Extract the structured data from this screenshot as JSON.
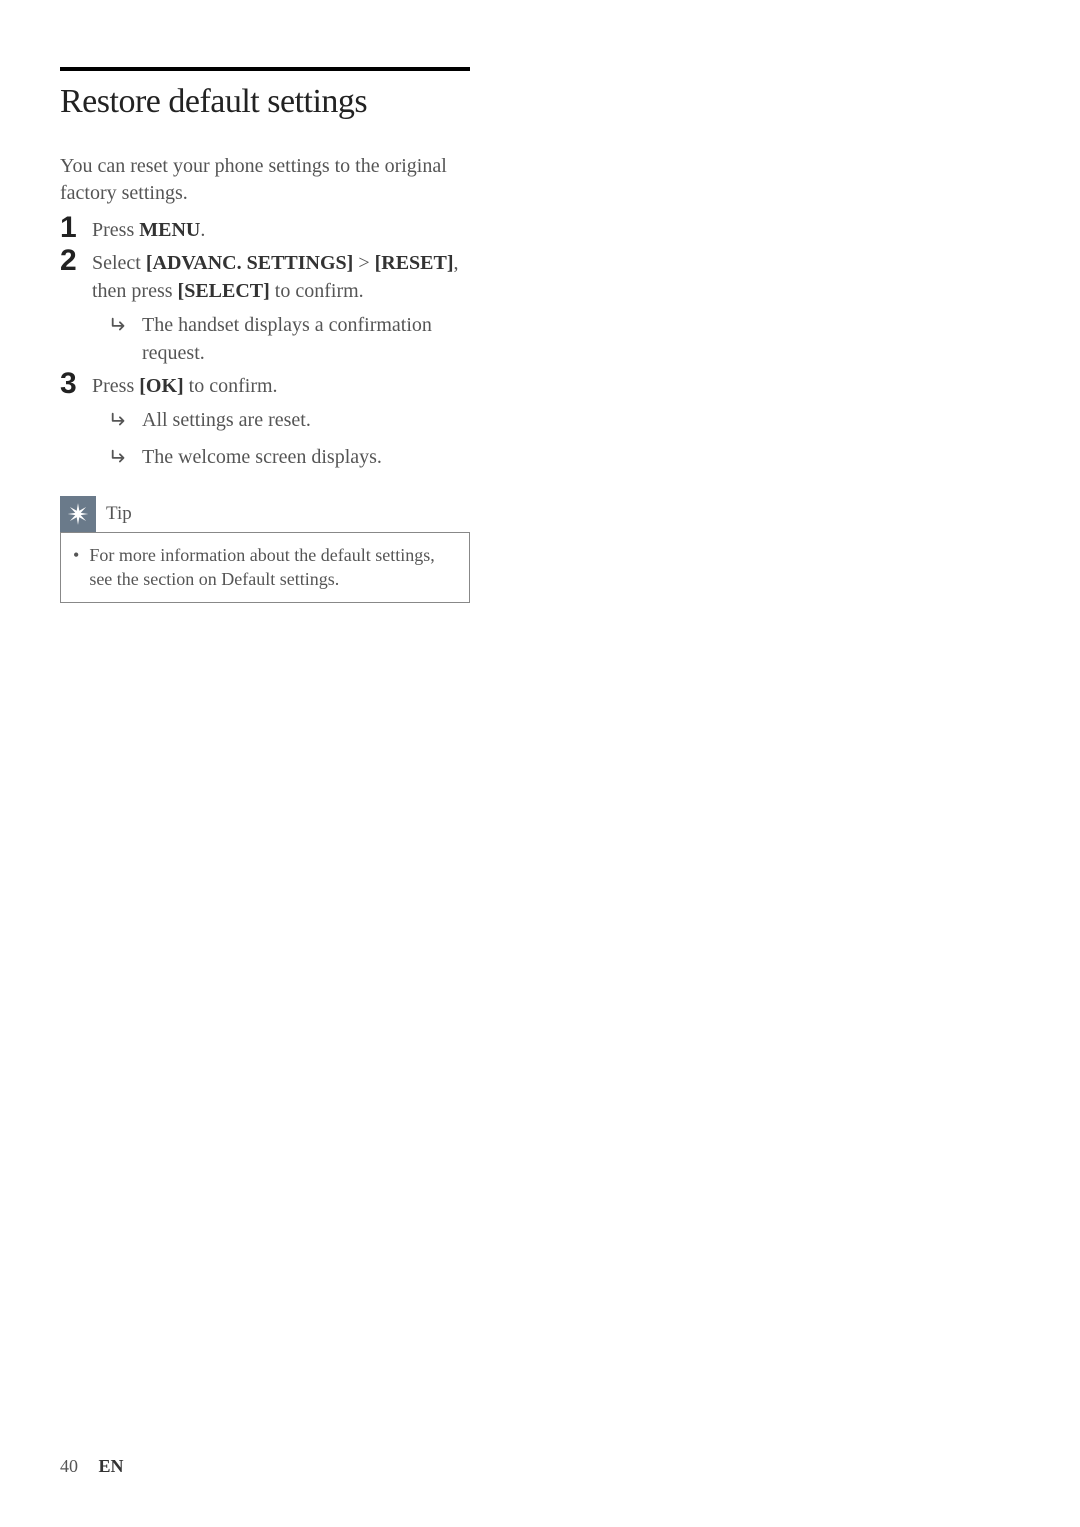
{
  "heading": "Restore default settings",
  "intro": "You can reset your phone settings to the original factory settings.",
  "steps": [
    {
      "num": "1",
      "text_pre": "Press ",
      "bold1": "MENU",
      "text_after": "."
    },
    {
      "num": "2",
      "text_pre": "Select ",
      "bold1": "[ADVANC. SETTINGS]",
      "text_mid1": " > ",
      "bold2": "[RESET]",
      "text_mid2": ", then press ",
      "bold3": "[SELECT]",
      "text_after": " to confirm.",
      "results": [
        "The handset displays a confirmation request."
      ]
    },
    {
      "num": "3",
      "text_pre": "Press ",
      "bold1": "[OK]",
      "text_after": " to confirm.",
      "results": [
        "All settings are reset.",
        "The welcome screen displays."
      ]
    }
  ],
  "tip": {
    "label": "Tip",
    "text": "For more information about the default settings, see the section on Default settings."
  },
  "footer": {
    "page": "40",
    "lang": "EN"
  }
}
